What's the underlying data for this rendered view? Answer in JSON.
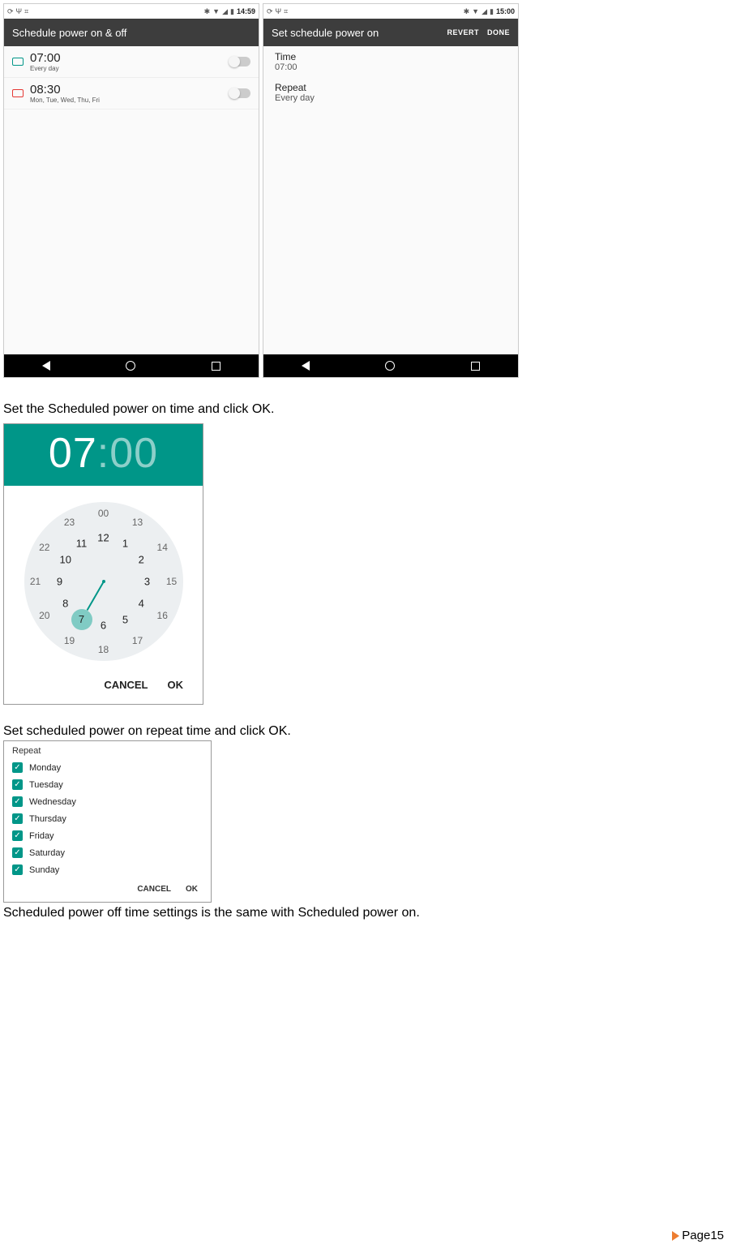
{
  "statusbar": {
    "left_time": "14:59",
    "right_time": "15:00",
    "bt_icon": "✱",
    "wifi_icon": "▼",
    "sig_icon": "◢",
    "batt_icon": "▮"
  },
  "screenA": {
    "title": "Schedule power on & off",
    "rows": [
      {
        "time": "07:00",
        "sub": "Every day"
      },
      {
        "time": "08:30",
        "sub": "Mon, Tue, Wed, Thu, Fri"
      }
    ]
  },
  "screenB": {
    "title": "Set schedule power on",
    "revert": "REVERT",
    "done": "DONE",
    "rows": [
      {
        "label": "Time",
        "value": "07:00"
      },
      {
        "label": "Repeat",
        "value": "Every day"
      }
    ]
  },
  "text": {
    "p1": "Set the Scheduled power on time and click OK.",
    "p2": "Set scheduled power on repeat time and click OK.",
    "p3": "Scheduled power off time settings is the same with Scheduled power on."
  },
  "timepicker": {
    "hours": "07",
    "colon": ":",
    "minutes": "00",
    "cancel": "CANCEL",
    "ok": "OK",
    "outer": [
      "00",
      "13",
      "14",
      "15",
      "16",
      "17",
      "18",
      "19",
      "20",
      "21",
      "22",
      "23"
    ],
    "inner": [
      "12",
      "1",
      "2",
      "3",
      "4",
      "5",
      "6",
      "7",
      "8",
      "9",
      "10",
      "11"
    ],
    "selected_inner_index": 7
  },
  "repeat": {
    "title": "Repeat",
    "days": [
      "Monday",
      "Tuesday",
      "Wednesday",
      "Thursday",
      "Friday",
      "Saturday",
      "Sunday"
    ],
    "cancel": "CANCEL",
    "ok": "OK"
  },
  "footer": {
    "label": "Page15"
  }
}
